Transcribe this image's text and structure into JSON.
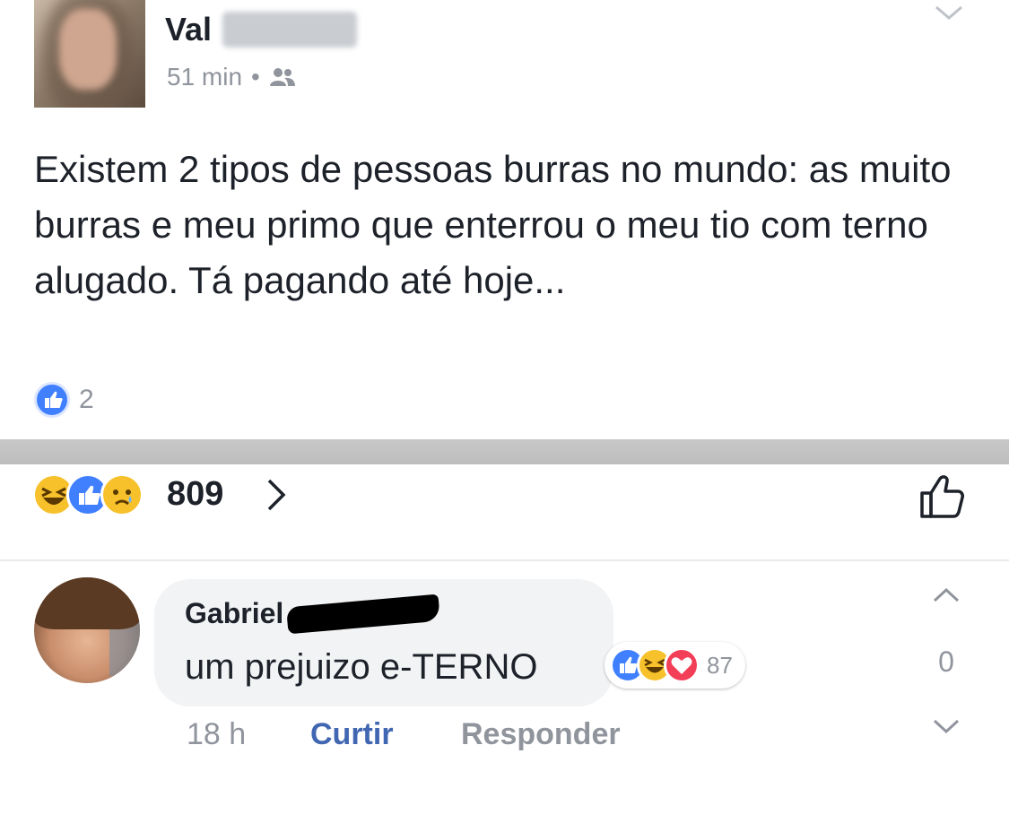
{
  "post": {
    "author": "Val",
    "time": "51 min",
    "separator": "•",
    "audience_icon": "friends-icon",
    "text": "Existem 2 tipos de pessoas burras no mundo: as muito burras e meu primo que enterrou o meu tio com terno alugado. Tá pagando até hoje...",
    "reaction_count": "2"
  },
  "reaction_bar": {
    "icons": [
      "haha-emoji-icon",
      "like-emoji-icon",
      "sad-emoji-icon"
    ],
    "total": "809",
    "arrow": ">",
    "like_button_icon": "thumbs-up-outline-icon"
  },
  "comment": {
    "author": "Gabriel",
    "text": "um prejuizo e-TERNO",
    "reaction_icons": [
      "like-emoji-icon",
      "haha-emoji-icon",
      "love-emoji-icon"
    ],
    "reaction_count": "87",
    "time": "18 h",
    "like_label": "Curtir",
    "reply_label": "Responder",
    "vote_count": "0"
  },
  "colors": {
    "link_blue": "#4267b2",
    "like_blue": "#4080ff",
    "meta_gray": "#90949c",
    "bubble_gray": "#f2f3f5",
    "haha_yellow": "#f7c12b",
    "love_red": "#f33e58"
  }
}
